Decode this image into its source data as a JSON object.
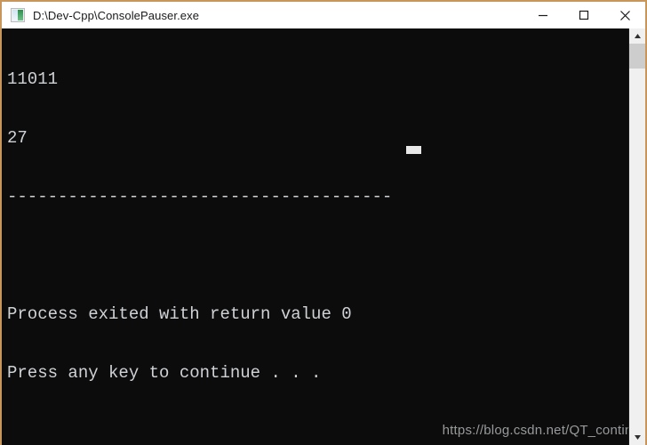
{
  "window": {
    "title": "D:\\Dev-Cpp\\ConsolePauser.exe",
    "icon": "console-app-icon",
    "border_color": "#c8965a",
    "titlebar_bg": "#ffffff",
    "titlebar_fg": "#1a1a1a"
  },
  "window_controls": {
    "minimize": {
      "name": "minimize-button",
      "glyph": "—"
    },
    "maximize": {
      "name": "maximize-button",
      "glyph": "□"
    },
    "close": {
      "name": "close-button",
      "glyph": "✕"
    }
  },
  "console": {
    "background": "#0c0c0c",
    "foreground": "#cfd2d6",
    "lines": [
      "11011",
      "27",
      "--------------------------------------",
      "",
      "Process exited with return value 0",
      "Press any key to continue . . ."
    ],
    "cursor_visible": true
  },
  "watermark": {
    "text": "https://blog.csdn.net/QT_continu",
    "color": "#97999b"
  },
  "scrollbar": {
    "up_arrow": "scroll-up-arrow",
    "down_arrow": "scroll-down-arrow",
    "thumb_position": "top",
    "track_color": "#f0f0f0",
    "thumb_color": "#cdcdcd"
  }
}
